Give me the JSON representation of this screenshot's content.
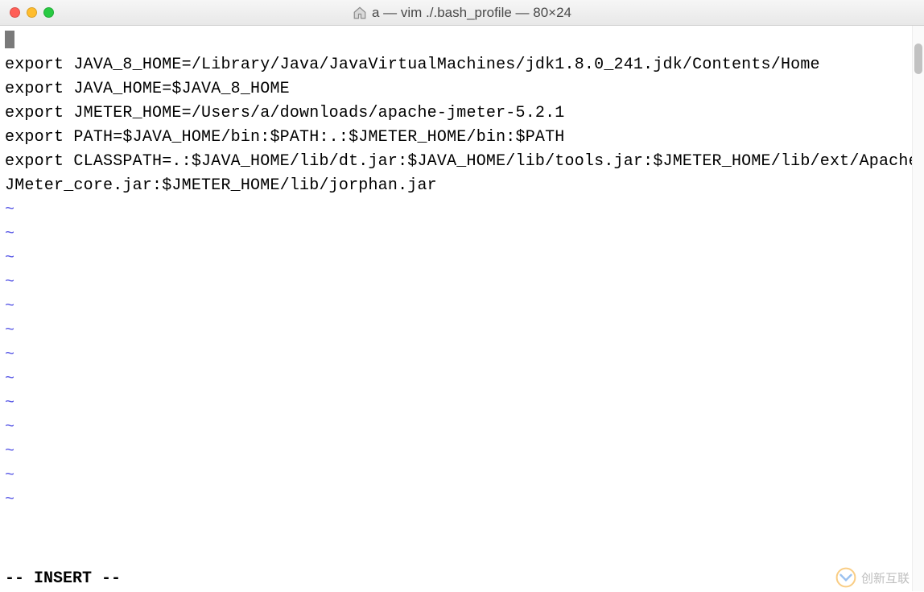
{
  "titlebar": {
    "title": "a — vim ./.bash_profile — 80×24"
  },
  "editor": {
    "lines": [
      "",
      "export JAVA_8_HOME=/Library/Java/JavaVirtualMachines/jdk1.8.0_241.jdk/Contents/Home",
      "export JAVA_HOME=$JAVA_8_HOME",
      "export JMETER_HOME=/Users/a/downloads/apache-jmeter-5.2.1",
      "export PATH=$JAVA_HOME/bin:$PATH:.:$JMETER_HOME/bin:$PATH",
      "export CLASSPATH=.:$JAVA_HOME/lib/dt.jar:$JAVA_HOME/lib/tools.jar:$JMETER_HOME/lib/ext/ApacheJMeter_core.jar:$JMETER_HOME/lib/jorphan.jar"
    ],
    "tilde_count": 13,
    "tilde_char": "~"
  },
  "status": {
    "mode": "-- INSERT --"
  },
  "watermark": {
    "text": "创新互联"
  }
}
